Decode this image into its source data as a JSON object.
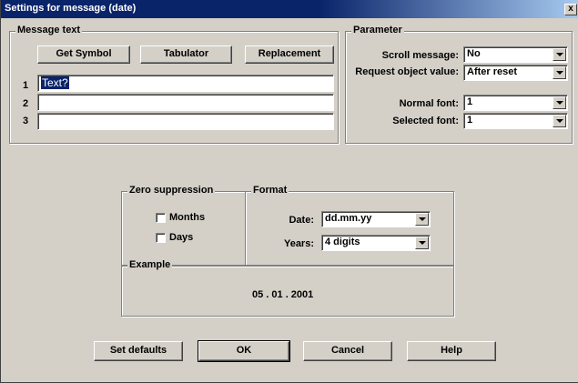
{
  "window": {
    "title": "Settings for message (date)",
    "close_glyph": "x"
  },
  "message_text": {
    "group_label": "Message text",
    "buttons": {
      "get_symbol": "Get Symbol",
      "tabulator": "Tabulator",
      "replacement": "Replacement"
    },
    "rows": [
      {
        "num": "1",
        "value": "Text?"
      },
      {
        "num": "2",
        "value": ""
      },
      {
        "num": "3",
        "value": ""
      }
    ]
  },
  "parameter": {
    "group_label": "Parameter",
    "scroll_message": {
      "label": "Scroll message:",
      "value": "No"
    },
    "request_object_value": {
      "label": "Request object value:",
      "value": "After reset"
    },
    "normal_font": {
      "label": "Normal font:",
      "value": "1"
    },
    "selected_font": {
      "label": "Selected font:",
      "value": "1"
    }
  },
  "zero_suppression": {
    "group_label": "Zero suppression",
    "months": {
      "label": "Months",
      "checked": false
    },
    "days": {
      "label": "Days",
      "checked": false
    }
  },
  "format": {
    "group_label": "Format",
    "date": {
      "label": "Date:",
      "value": "dd.mm.yy"
    },
    "years": {
      "label": "Years:",
      "value": "4 digits"
    }
  },
  "example": {
    "group_label": "Example",
    "value": "05 . 01 . 2001"
  },
  "footer": {
    "set_defaults": "Set defaults",
    "ok": "OK",
    "cancel": "Cancel",
    "help": "Help"
  }
}
